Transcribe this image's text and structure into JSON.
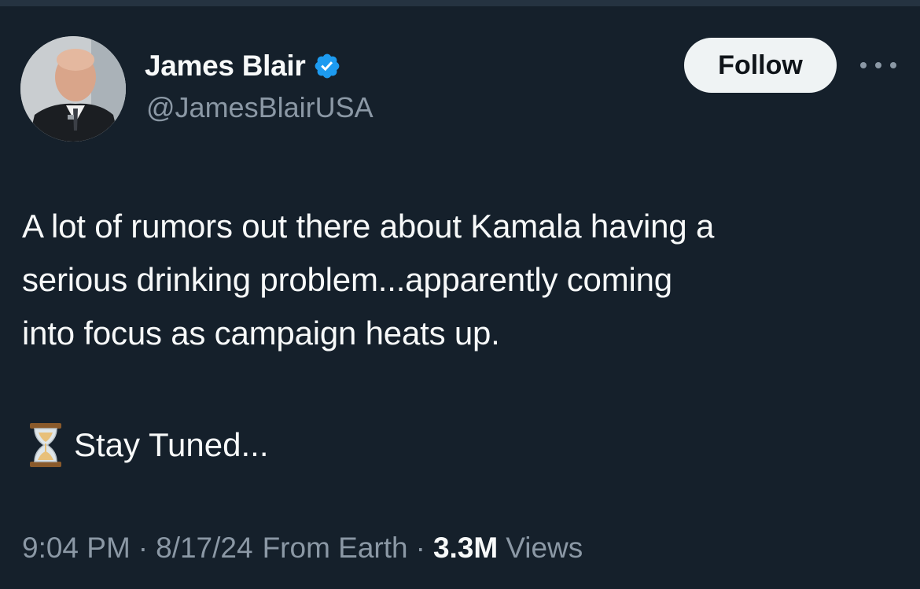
{
  "tweet": {
    "author": {
      "display_name": "James Blair",
      "handle": "@JamesBlairUSA",
      "verified": true,
      "avatar_icon": "profile-photo"
    },
    "follow_label": "Follow",
    "more_icon": "more-options-icon",
    "text_lines": [
      "A lot of rumors out there about Kamala having a",
      "serious drinking problem...apparently coming",
      "into focus as campaign heats up."
    ],
    "stay_tuned": "Stay Tuned...",
    "stay_tuned_emoji": "hourglass-icon",
    "meta": {
      "time": "9:04 PM",
      "date": "8/17/24",
      "source": "From Earth",
      "separator": "·",
      "views_count": "3.3M",
      "views_label": "Views"
    }
  },
  "colors": {
    "background": "#15202b",
    "text": "#f7f9f9",
    "secondary_text": "#8b98a5",
    "follow_button_bg": "#eff3f4",
    "verified_badge": "#1d9bf0"
  }
}
